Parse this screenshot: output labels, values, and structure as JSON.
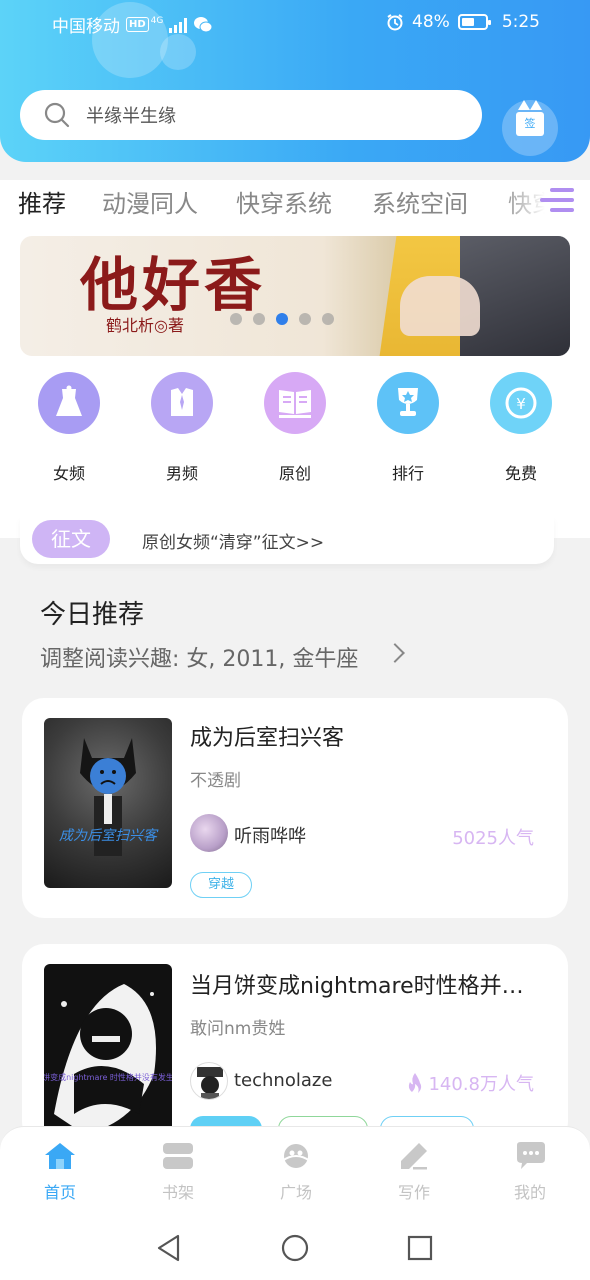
{
  "status_bar": {
    "carrier": "中国移动",
    "network_badge": "HD",
    "network_gen": "4G",
    "battery": "48%",
    "time": "5:25"
  },
  "search": {
    "placeholder": "半缘半生缘",
    "icon": "search-icon"
  },
  "checkin": {
    "label": "签",
    "icon": "gift-icon"
  },
  "tabs": [
    {
      "label": "推荐",
      "active": true
    },
    {
      "label": "动漫同人",
      "active": false
    },
    {
      "label": "快穿系统",
      "active": false
    },
    {
      "label": "系统空间",
      "active": false
    },
    {
      "label": "快穿",
      "active": false
    }
  ],
  "banner": {
    "title": "他好香",
    "author": "鹤北析◎著",
    "slide_count": 5,
    "active_slide": 2
  },
  "categories": [
    {
      "label": "女频",
      "icon": "dress-icon",
      "color": "#a89cf3"
    },
    {
      "label": "男频",
      "icon": "shirt-icon",
      "color": "#b8a6f4"
    },
    {
      "label": "原创",
      "icon": "book-icon",
      "color": "#d7a9f5"
    },
    {
      "label": "排行",
      "icon": "trophy-icon",
      "color": "#5ec2f7"
    },
    {
      "label": "免费",
      "icon": "coin-icon",
      "color": "#6fd3f8"
    }
  ],
  "notice": {
    "tag": "征文",
    "text": "原创女频“清穿”征文>>"
  },
  "recommend": {
    "title": "今日推荐",
    "subtitle": "调整阅读兴趣: 女, 2011, 金牛座"
  },
  "books": [
    {
      "title": "成为后室扫兴客",
      "intro": "不透剧",
      "author": "听雨哗哗",
      "popularity": "5025人气",
      "tags": [
        "穿越"
      ],
      "cover_text": "成为后室扫兴客"
    },
    {
      "title": "当月饼变成nightmare时性格并…",
      "intro": "敢问nm贵姓",
      "author": "technolaze",
      "popularity": "140.8万人气",
      "tags": [
        "",
        "",
        ""
      ],
      "cover_text": "当月饼变成nightmare 时性格并没有发生变化"
    }
  ],
  "bottom_nav": [
    {
      "label": "首页",
      "icon": "home-icon",
      "active": true
    },
    {
      "label": "书架",
      "icon": "bookshelf-icon",
      "active": false
    },
    {
      "label": "广场",
      "icon": "planet-icon",
      "active": false
    },
    {
      "label": "写作",
      "icon": "pen-icon",
      "active": false
    },
    {
      "label": "我的",
      "icon": "chat-bubble-icon",
      "active": false
    }
  ],
  "colors": {
    "header_start": "#5cd3f8",
    "header_end": "#3799f4",
    "accent_purple": "#b693f0",
    "accent_blue": "#3aa8f5"
  }
}
